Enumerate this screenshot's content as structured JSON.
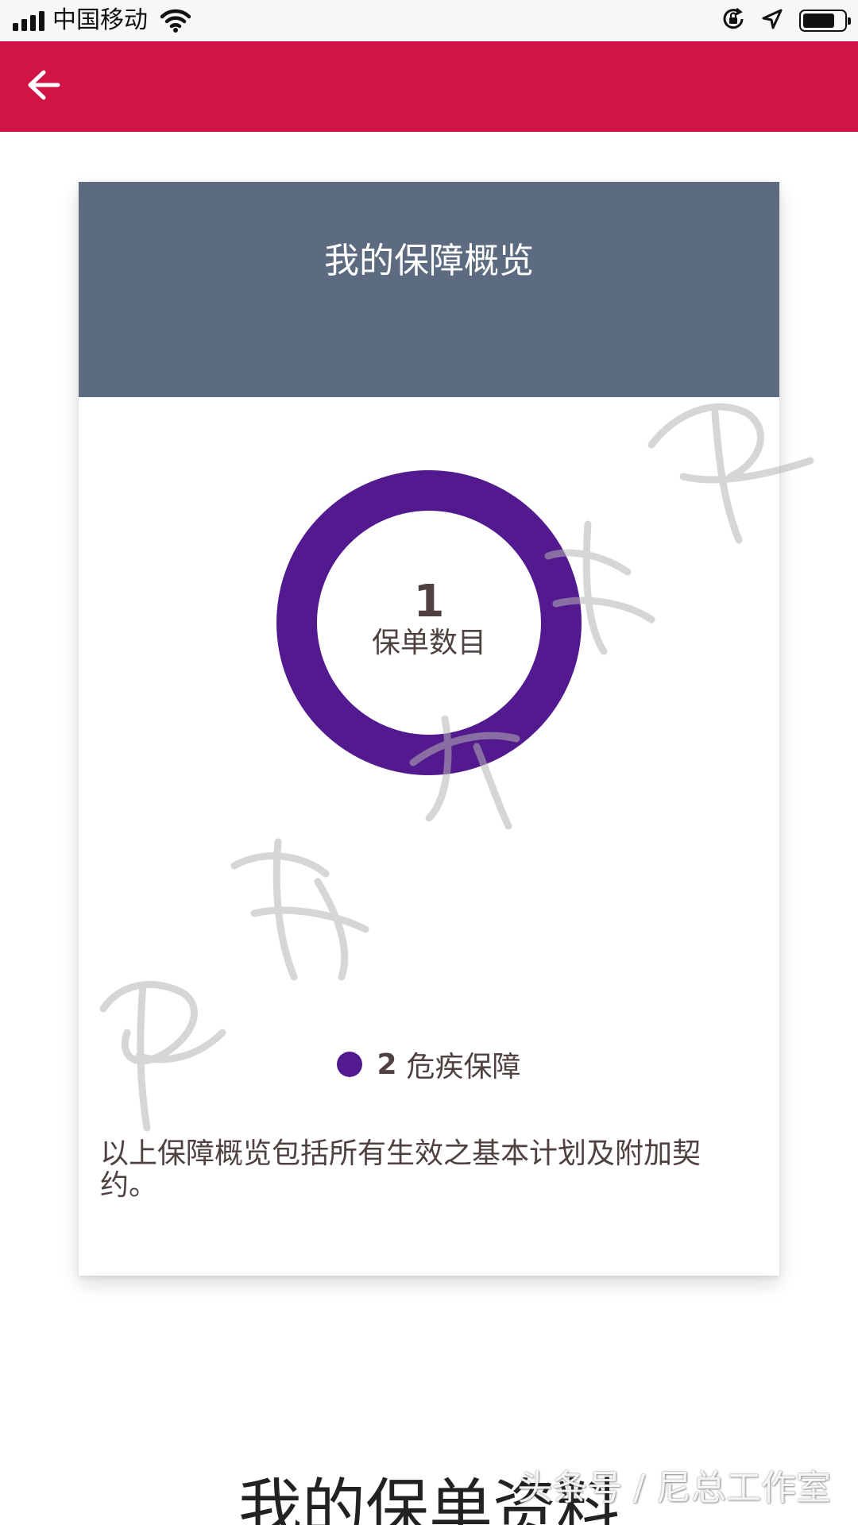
{
  "status_bar": {
    "carrier": "中国移动",
    "battery_level": 0.78,
    "icons": [
      "signal-icon",
      "wifi-icon",
      "orientation-lock-icon",
      "location-icon",
      "battery-icon"
    ]
  },
  "app_bar": {
    "color": "#d21345",
    "back_icon": "arrow-left-icon"
  },
  "overview": {
    "title": "我的保障概览",
    "header_color": "#5c6b80",
    "policy_count": "1",
    "policy_count_label": "保单数目",
    "donut_color": "#531a8f",
    "legend": [
      {
        "count": "2",
        "label": "危疾保障",
        "color": "#531a8f"
      }
    ],
    "note": "以上保障概览包括所有生效之基本计划及附加契约。"
  },
  "next_section": {
    "title": "我的保单资料"
  },
  "watermark": {
    "text": "头条号 / 尼总工作室"
  }
}
